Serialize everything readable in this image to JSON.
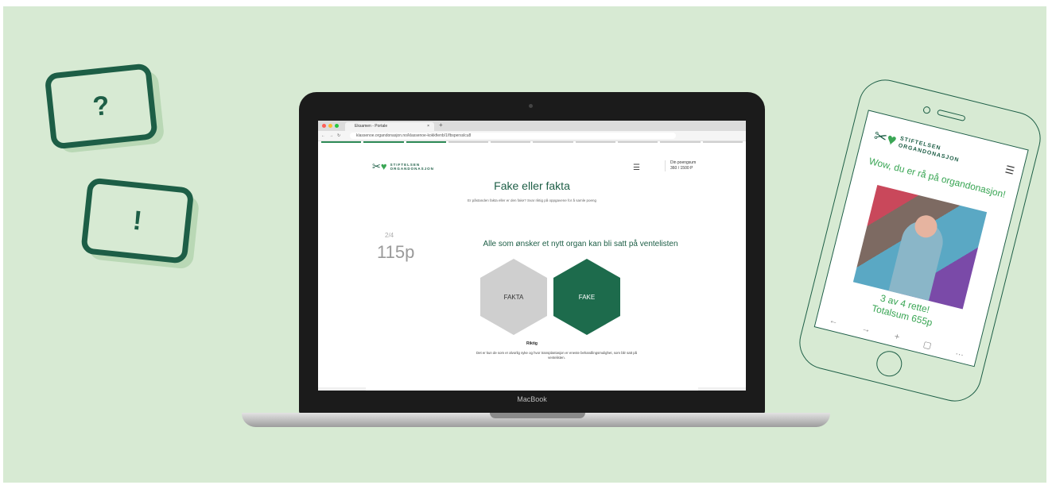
{
  "bubbles": [
    {
      "glyph": "?"
    },
    {
      "glyph": "!"
    }
  ],
  "laptop": {
    "brand": "MacBook",
    "browser": {
      "tab_title": "Eksamen - Portale",
      "close_glyph": "×",
      "new_tab_glyph": "+",
      "url": "klassenoe.organdonasjon.no/klassenoe-kokkfienb/1/fbspersslcu8",
      "progress_total": 10,
      "progress_done": 3
    },
    "page": {
      "logo_line1": "STIFTELSEN",
      "logo_line2": "ORGANDONASJON",
      "menu_icon": "☰",
      "score_label": "Din poengsum",
      "score_value": "360 / 1500 P",
      "title": "Fake eller fakta",
      "subtitle": "Er påstanden fakta eller er den fake? Svar riktig på oppgavene for å samle poeng",
      "counter": "2/4",
      "points": "115p",
      "question": "Alle som ønsker et nytt organ kan bli satt på ventelisten",
      "option_fakta": "FAKTA",
      "option_fake": "FAKE",
      "verdict": "Riktig",
      "explanation": "Det er kun de som er alvorlig syke og hvor transplantasjon er eneste behandlingsmulighet, som blir satt på ventelisten."
    }
  },
  "phone": {
    "logo_line1": "STIFTELSEN",
    "logo_line2": "ORGANDONASJON",
    "menu_icon": "☰",
    "headline": "Wow, du er rå på organdonasjon!",
    "result": "3 av 4 rette!",
    "total": "Totalsum 655p",
    "toolbar": [
      "←",
      "→",
      "+",
      "▢",
      "…"
    ]
  }
}
